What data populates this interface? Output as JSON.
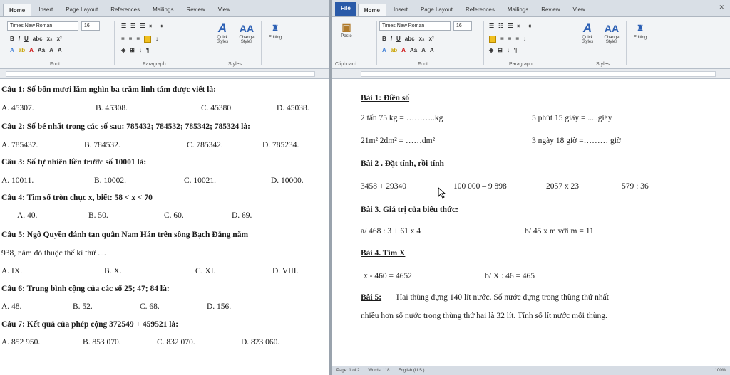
{
  "left": {
    "tabs": [
      "Home",
      "Insert",
      "Page Layout",
      "References",
      "Mailings",
      "Review",
      "View"
    ],
    "font_name": "Times New Roman",
    "font_size": "16",
    "groups": {
      "font": "Font",
      "paragraph": "Paragraph",
      "styles": "Styles"
    },
    "quick_styles": "Quick Styles",
    "change_styles": "Change Styles",
    "editing": "Editing",
    "questions": [
      {
        "q": "Câu 1: Số bốn mươi lăm nghìn ba trăm linh tám được viết là:",
        "opts": [
          "A. 45307.",
          "B. 45308.",
          "C. 45380.",
          "D. 45038."
        ]
      },
      {
        "q": "Câu 2: Số bé nhất trong các số sau: 785432; 784532; 785342; 785324 là:",
        "opts": [
          "A. 785432.",
          "B. 784532.",
          "C. 785342.",
          "D. 785234."
        ]
      },
      {
        "q": "Câu 3: Số tự nhiên liền trước số 10001 là:",
        "opts": [
          "A. 10011.",
          "B. 10002.",
          "C. 10021.",
          "D. 10000."
        ]
      },
      {
        "q": "Câu 4: Tìm số tròn chục x, biết: 58 < x < 70",
        "opts": [
          "A. 40.",
          "B. 50.",
          "C. 60.",
          "D. 69."
        ]
      },
      {
        "q": "Câu 5: Ngô Quyền đánh tan quân Nam Hán trên sông Bạch Đằng năm",
        "q2": "938, năm đó thuộc thế kỉ thứ ....",
        "opts": [
          "A. IX.",
          "B. X.",
          "C. XI.",
          "D. VIII."
        ]
      },
      {
        "q": "Câu 6: Trung bình cộng của các số 25; 47; 84 là:",
        "opts": [
          "A. 48.",
          "B. 52.",
          "C. 68.",
          "D. 156."
        ]
      },
      {
        "q": "Câu 7: Kết quả của phép cộng 372549 + 459521 là:",
        "opts": [
          "A. 852 950.",
          "B. 853 070.",
          "C. 832 070.",
          "D. 823 060."
        ]
      }
    ]
  },
  "right": {
    "file_tab": "File",
    "tabs": [
      "Home",
      "Insert",
      "Page Layout",
      "References",
      "Mailings",
      "Review",
      "View"
    ],
    "font_name": "Times New Roman",
    "font_size": "16",
    "paste": "Paste",
    "groups": {
      "clipboard": "Clipboard",
      "font": "Font",
      "paragraph": "Paragraph",
      "styles": "Styles"
    },
    "quick_styles": "Quick Styles",
    "change_styles": "Change Styles",
    "editing": "Editing",
    "bai1": {
      "title": "Bài 1: Điền số",
      "a": "2 tấn 75 kg = ………..kg",
      "b": "5 phút 15 giây = .....giây",
      "c": "21m² 2dm² = ……dm²",
      "d": "3 ngày 18 giờ =……… giờ"
    },
    "bai2": {
      "title": "Bài 2 .  Đặt tính, rồi tính",
      "items": [
        "3458 + 29340",
        "100 000 – 9 898",
        "2057 x  23",
        "579 : 36"
      ]
    },
    "bai3": {
      "title": "Bài 3.  Giá trị của biểu thức:",
      "a": "a/ 468 : 3 + 61 x 4",
      "b": "b/ 45 x m với m = 11"
    },
    "bai4": {
      "title": "Bài 4. Tìm X",
      "a": "x  -  460 = 4652",
      "b": "b/  X  : 46 = 465"
    },
    "bai5": {
      "title": "Bài 5:",
      "text1": "Hai thùng đựng 140 lít nước. Số nước đựng trong thùng thứ nhất",
      "text2": "nhiều hơn số nước trong thùng thứ hai là 32 lít. Tính số lít nước mỗi thùng."
    },
    "status": {
      "page": "Page: 1 of 2",
      "words": "Words: 118",
      "lang": "English (U.S.)",
      "zoom": "100%"
    }
  },
  "colors": {
    "file_tab": "#2a5aa8",
    "ribbon": "#f2f4f6",
    "tab_bar": "#d9dfe6"
  }
}
